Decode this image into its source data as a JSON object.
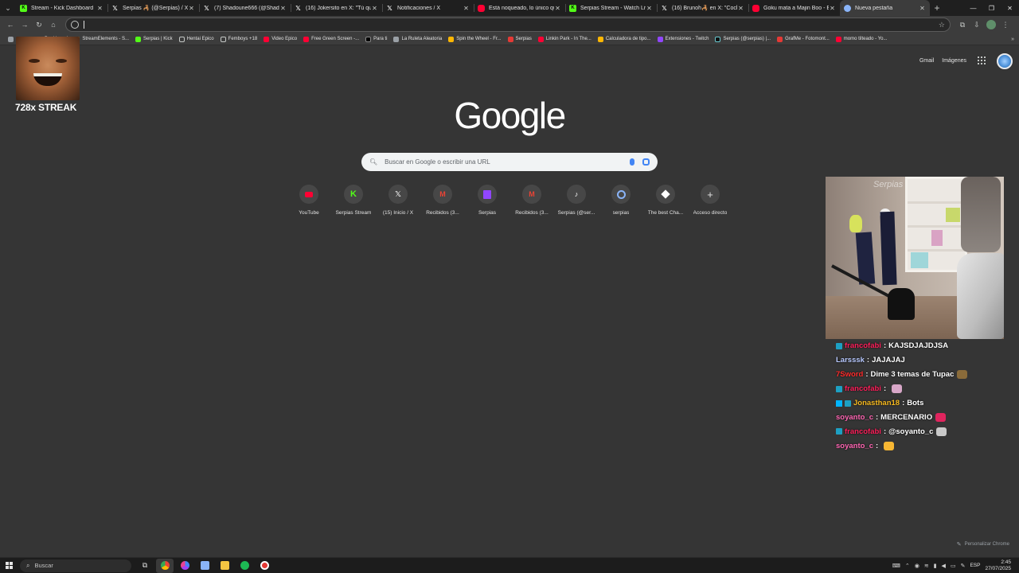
{
  "tabs": [
    {
      "title": "Stream - Kick Dashboard",
      "icon": "kick-icon",
      "active": false
    },
    {
      "title": "Serpias 🦂 (@Serpias) / X",
      "icon": "x-icon",
      "active": false
    },
    {
      "title": "(7) Shadoune666 (@Shadou",
      "icon": "x-icon",
      "active": false
    },
    {
      "title": "(16) Jokersito en X: \"Tú que l",
      "icon": "x-icon",
      "active": false
    },
    {
      "title": "Notificaciones / X",
      "icon": "x-icon",
      "active": false
    },
    {
      "title": "Está noqueado, lo único que",
      "icon": "youtube-icon",
      "active": false
    },
    {
      "title": "Serpias Stream - Watch Live o",
      "icon": "kick-icon",
      "active": false
    },
    {
      "title": "(16) Brunoh🦂 en X: \"Coche",
      "icon": "x-icon",
      "active": false
    },
    {
      "title": "Goku mata a Majin Boo - ÉPI",
      "icon": "youtube-icon",
      "active": false
    },
    {
      "title": "Nueva pestaña",
      "icon": "chrome-icon",
      "active": true
    }
  ],
  "window_controls": {
    "minimize": "—",
    "maximize": "❐",
    "close": "✕"
  },
  "omnibox": {
    "value": ""
  },
  "bookmarks": [
    {
      "label": "",
      "icon": "apps-icon",
      "kind": "gray"
    },
    {
      "label": "",
      "icon": "tiktok-icon",
      "kind": "tt"
    },
    {
      "label": "Dashboard",
      "icon": "twitch-icon",
      "kind": "tw"
    },
    {
      "label": "StreamElements - S...",
      "icon": "streamelements-icon",
      "kind": "misc"
    },
    {
      "label": "Serpias | Kick",
      "icon": "kick-icon",
      "kind": "kick"
    },
    {
      "label": "Hentai Epico",
      "icon": "folder-icon",
      "kind": "folder"
    },
    {
      "label": "Femboys +18",
      "icon": "folder-icon",
      "kind": "folder"
    },
    {
      "label": "Video Epico",
      "icon": "youtube-icon",
      "kind": "yt"
    },
    {
      "label": "Free Green Screen -...",
      "icon": "youtube-icon",
      "kind": "yt"
    },
    {
      "label": "Para ti",
      "icon": "x-icon",
      "kind": "x"
    },
    {
      "label": "La Ruleta Aleatoria",
      "icon": "wheel-icon",
      "kind": "gray"
    },
    {
      "label": "Spin the Wheel - Fr...",
      "icon": "wheel-icon",
      "kind": "misc"
    },
    {
      "label": "Serpias",
      "icon": "serpias-icon",
      "kind": "red"
    },
    {
      "label": "Linkin Park - In The...",
      "icon": "youtube-icon",
      "kind": "yt"
    },
    {
      "label": "Calculadora de tipo...",
      "icon": "calculator-icon",
      "kind": "misc"
    },
    {
      "label": "Extensiones - Twitch",
      "icon": "twitch-icon",
      "kind": "tw"
    },
    {
      "label": "Serpias (@serpias) |...",
      "icon": "tiktok-icon",
      "kind": "tt"
    },
    {
      "label": "GrafMe - Fotomont...",
      "icon": "grafme-icon",
      "kind": "red"
    },
    {
      "label": "momo tilteado - Yo...",
      "icon": "youtube-icon",
      "kind": "yt"
    }
  ],
  "overlay": {
    "streak_label": "728x STREAK"
  },
  "ntp": {
    "gmail": "Gmail",
    "images": "Imágenes",
    "logo": "Google",
    "search_placeholder": "Buscar en Google o escribir una URL",
    "shortcuts": [
      {
        "label": "YouTube",
        "icon": "youtube-icon"
      },
      {
        "label": "Serpias Stream",
        "icon": "kick-icon"
      },
      {
        "label": "(15) Inicio / X",
        "icon": "x-icon"
      },
      {
        "label": "Recibidos (3...",
        "icon": "gmail-icon"
      },
      {
        "label": "Serpias",
        "icon": "twitch-icon"
      },
      {
        "label": "Recibidos (3...",
        "icon": "gmail-icon"
      },
      {
        "label": "Serpias (@ser...",
        "icon": "tiktok-icon"
      },
      {
        "label": "serpias",
        "icon": "streamelements-icon"
      },
      {
        "label": "The best Cha...",
        "icon": "diamond-icon"
      },
      {
        "label": "Acceso directo",
        "icon": "plus-icon"
      }
    ],
    "customize_label": "Personalizar Chrome"
  },
  "webcam": {
    "sign_text": "Serpias"
  },
  "chat": [
    {
      "badge": "mod",
      "user": "francofabi",
      "user_color": "#ff1e5a",
      "text": "KAJSDJAJDJSA",
      "emote": ""
    },
    {
      "badge": "",
      "user": "Larsssk",
      "user_color": "#b8c9ff",
      "text": "JAJAJAJ",
      "emote": ""
    },
    {
      "badge": "",
      "user": "7Sword",
      "user_color": "#ff2b2b",
      "text": "Dime 3 temas de Tupac",
      "emote": "#8a6b3a"
    },
    {
      "badge": "mod",
      "user": "francofabi",
      "user_color": "#ff1e5a",
      "text": "",
      "emote": "#d8a7c8"
    },
    {
      "badge": "vip",
      "user": "Jonasthan18",
      "user_color": "#f5b81f",
      "text": "Bots",
      "emote": ""
    },
    {
      "badge": "",
      "user": "soyanto_c",
      "user_color": "#ff66b3",
      "text": "MERCENARIO",
      "emote": "#e0245e"
    },
    {
      "badge": "mod",
      "user": "francofabi",
      "user_color": "#ff1e5a",
      "text": "@soyanto_c",
      "emote": "#c9c9c9"
    },
    {
      "badge": "",
      "user": "soyanto_c",
      "user_color": "#ff66b3",
      "text": "",
      "emote": "#f7b733"
    }
  ],
  "taskbar": {
    "search_label": "Buscar",
    "language": "ESP",
    "time": "2:45",
    "date": "27/07/2025"
  }
}
